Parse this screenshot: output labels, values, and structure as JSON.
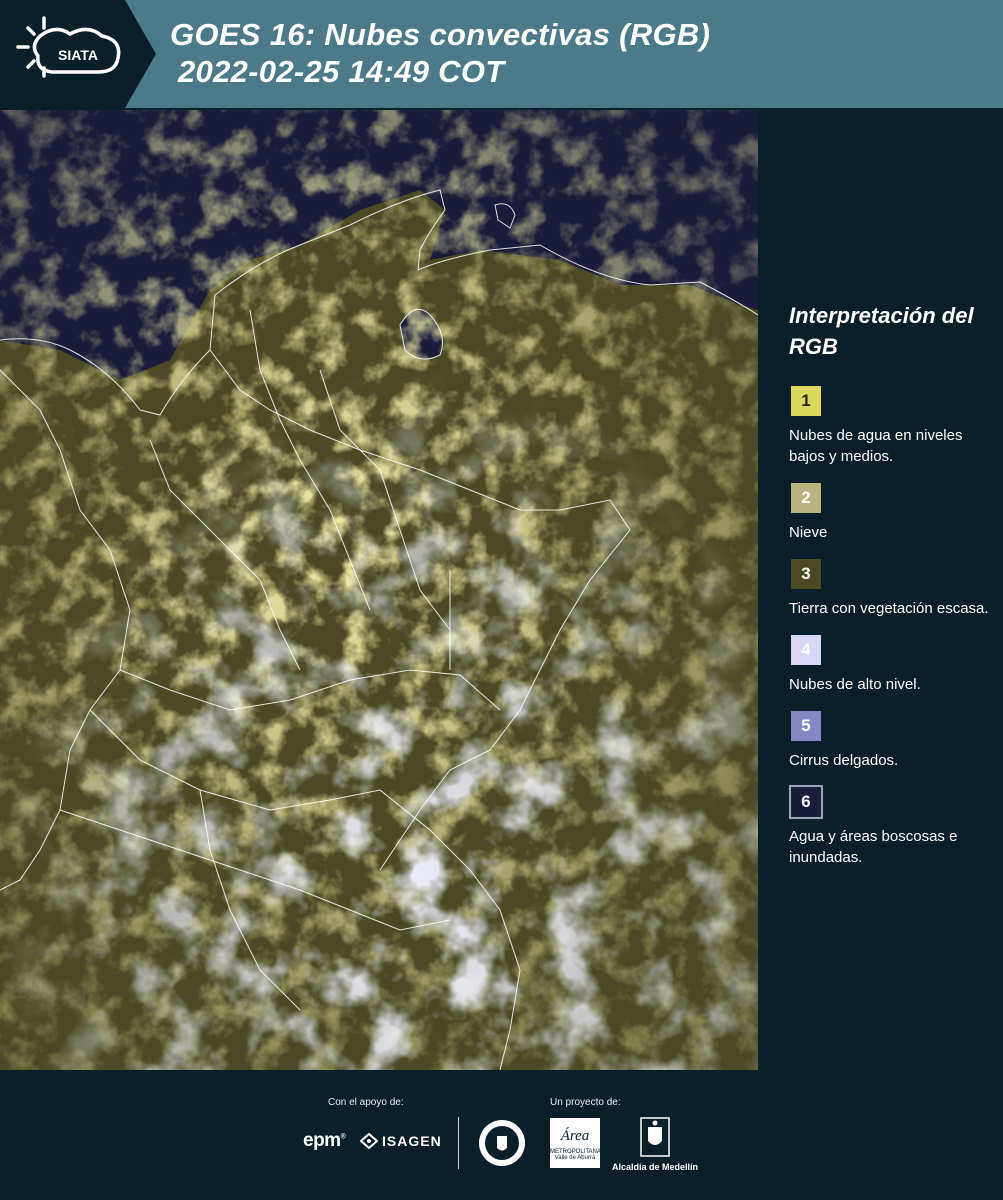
{
  "header": {
    "logo_text": "SIATA",
    "title_line1": "GOES 16: Nubes convectivas (RGB)",
    "title_line2": "2022-02-25 14:49 COT",
    "background_color": "#4d7a88",
    "logo_band_color": "#0b1f2b"
  },
  "map": {
    "icon": "satellite-rgb-image",
    "colors": {
      "ocean": "#1b1c3a",
      "low_clouds": "#dcd860",
      "vegetation": "#4b4a24",
      "high_clouds": "#d8d8f6",
      "boundaries": "#ffffff"
    }
  },
  "legend": {
    "title": "Interpretación del RGB",
    "items": [
      {
        "number": "1",
        "label": "Nubes de agua en niveles bajos y medios.",
        "color": "#dcd860",
        "text_color": "#2a2a10"
      },
      {
        "number": "2",
        "label": "Nieve",
        "color": "#b7b37e",
        "text_color": "#ffffff"
      },
      {
        "number": "3",
        "label": "Tierra con vegetación escasa.",
        "color": "#4b4a24",
        "text_color": "#ffffff"
      },
      {
        "number": "4",
        "label": "Nubes de alto nivel.",
        "color": "#d8d8f6",
        "text_color": "#ffffff"
      },
      {
        "number": "5",
        "label": "Cirrus delgados.",
        "color": "#8686c2",
        "text_color": "#ffffff"
      },
      {
        "number": "6",
        "label": "Agua y áreas boscosas e inundadas.",
        "color": "#1b1c3a",
        "text_color": "#ffffff"
      }
    ]
  },
  "footer": {
    "support_label": "Con el apoyo de:",
    "project_label": "Un proyecto de:",
    "epm": "epm",
    "isagen": "ISAGEN",
    "area_metropolitana": "Área",
    "area_sub": "METROPOLITANA",
    "area_sub2": "Valle de Aburrá",
    "alcaldia": "Alcaldía de Medellín"
  }
}
